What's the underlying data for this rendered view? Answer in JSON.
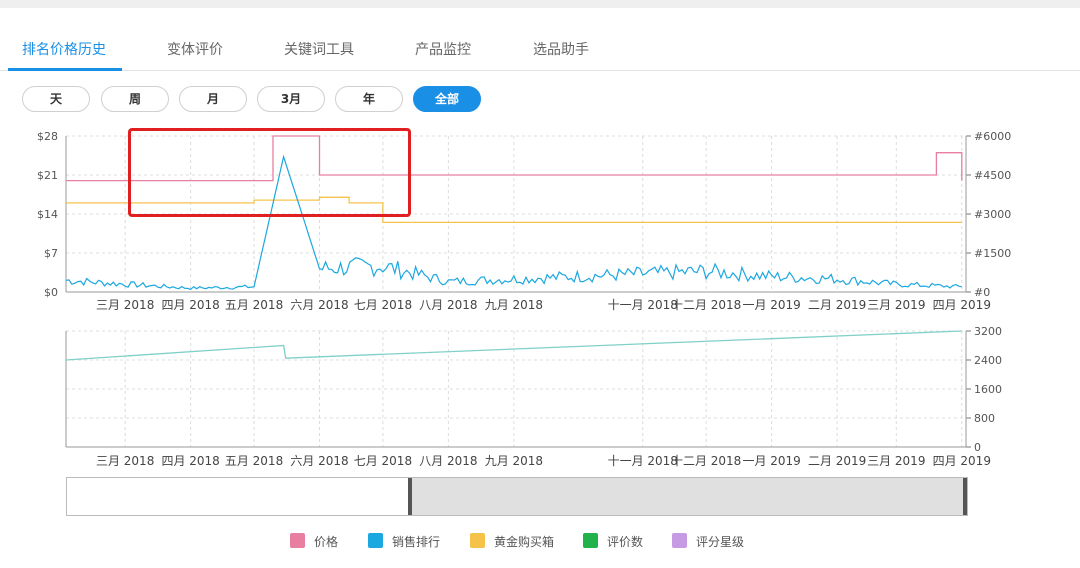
{
  "tabs": [
    {
      "label": "排名价格历史",
      "active": true
    },
    {
      "label": "变体评价",
      "active": false
    },
    {
      "label": "关键词工具",
      "active": false
    },
    {
      "label": "产品监控",
      "active": false
    },
    {
      "label": "选品助手",
      "active": false
    }
  ],
  "range_buttons": [
    {
      "label": "天",
      "active": false
    },
    {
      "label": "周",
      "active": false
    },
    {
      "label": "月",
      "active": false
    },
    {
      "label": "3月",
      "active": false
    },
    {
      "label": "年",
      "active": false
    },
    {
      "label": "全部",
      "active": true
    }
  ],
  "chart_data": [
    {
      "type": "line",
      "x_ticks": [
        "三月 2018",
        "四月 2018",
        "五月 2018",
        "六月 2018",
        "七月 2018",
        "八月 2018",
        "九月 2018",
        "十一月 2018",
        "十二月 2018",
        "一月 2019",
        "二月 2019",
        "三月 2019",
        "四月 2019"
      ],
      "y_left_ticks": [
        "$0",
        "$7",
        "$14",
        "$21",
        "$28"
      ],
      "y_left_lim": [
        0,
        28
      ],
      "y_right_ticks": [
        "#0",
        "#1500",
        "#3000",
        "#4500",
        "#6000"
      ],
      "y_right_lim": [
        0,
        6000
      ],
      "grid": true,
      "series": [
        {
          "name": "价格",
          "color": "#e87fa0",
          "axis": "left",
          "x": [
            "2018-02",
            "2018-03",
            "2018-04",
            "2018-05",
            "2018-05-10",
            "2018-06",
            "2018-07",
            "2018-08",
            "2018-09",
            "2018-10",
            "2018-11",
            "2018-12",
            "2019-01",
            "2019-02",
            "2019-03",
            "2019-03-20",
            "2019-04"
          ],
          "values": [
            20,
            20,
            20,
            20,
            28,
            21,
            21,
            21,
            21,
            21,
            21,
            21,
            21,
            21,
            21,
            25,
            20
          ]
        },
        {
          "name": "黄金购买箱",
          "color": "#f5c349",
          "axis": "left",
          "x": [
            "2018-02",
            "2018-03",
            "2018-04",
            "2018-05",
            "2018-06",
            "2018-06-15",
            "2018-07",
            "2018-08",
            "2018-09",
            "2018-10",
            "2018-11",
            "2018-12",
            "2019-01",
            "2019-02",
            "2019-03",
            "2019-04"
          ],
          "values": [
            16,
            16,
            16,
            16.5,
            17,
            16,
            12.5,
            12.5,
            12.5,
            12.5,
            12.5,
            12.5,
            12.5,
            12.5,
            12.5,
            12.5
          ]
        },
        {
          "name": "销售排行",
          "color": "#1ba7e0",
          "axis": "right",
          "x": [
            "2018-02",
            "2018-03",
            "2018-04",
            "2018-05",
            "2018-05-15",
            "2018-06",
            "2018-07",
            "2018-08",
            "2018-09",
            "2018-10",
            "2018-11",
            "2018-12",
            "2019-01",
            "2019-02",
            "2019-03",
            "2019-04"
          ],
          "values": [
            450,
            300,
            150,
            200,
            5200,
            900,
            1000,
            400,
            500,
            600,
            700,
            800,
            600,
            500,
            300,
            200
          ]
        }
      ]
    },
    {
      "type": "line",
      "x_ticks": [
        "三月 2018",
        "四月 2018",
        "五月 2018",
        "六月 2018",
        "七月 2018",
        "八月 2018",
        "九月 2018",
        "十一月 2018",
        "十二月 2018",
        "一月 2019",
        "二月 2019",
        "三月 2019",
        "四月 2019"
      ],
      "y_right_ticks": [
        "0",
        "800",
        "1600",
        "2400",
        "3200"
      ],
      "y_right_lim": [
        0,
        3200
      ],
      "grid": true,
      "series": [
        {
          "name": "评价数",
          "color": "#7fd0c8",
          "axis": "right",
          "x": [
            "2018-02",
            "2018-05-15",
            "2018-05-16",
            "2019-04"
          ],
          "values": [
            2400,
            2800,
            2450,
            3200
          ]
        }
      ]
    }
  ],
  "legend": [
    {
      "label": "价格",
      "color": "#e87fa0"
    },
    {
      "label": "销售排行",
      "color": "#1ba7e0"
    },
    {
      "label": "黄金购买箱",
      "color": "#f5c349"
    },
    {
      "label": "评价数",
      "color": "#21b24b"
    },
    {
      "label": "评分星级",
      "color": "#c79be3"
    }
  ]
}
